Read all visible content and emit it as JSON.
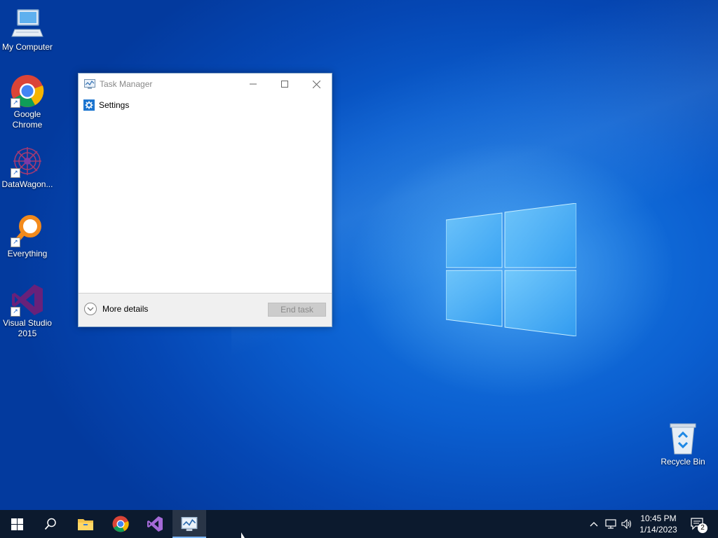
{
  "desktop": {
    "icons": [
      {
        "label": "My Computer"
      },
      {
        "label": "Google Chrome"
      },
      {
        "label": "DataWagon..."
      },
      {
        "label": "Everything"
      },
      {
        "label": "Visual Studio 2015"
      },
      {
        "label": "Recycle Bin"
      }
    ]
  },
  "task_manager": {
    "title": "Task Manager",
    "processes": [
      {
        "label": "Settings",
        "icon": "gear-icon"
      }
    ],
    "more_details_label": "More details",
    "end_task_label": "End task"
  },
  "taskbar": {
    "clock_time": "10:45 PM",
    "clock_date": "1/14/2023",
    "notification_count": "2"
  },
  "colors": {
    "accent": "#1b74cf",
    "taskbar": "#0c1a2e",
    "desktop": "#0b5fd0"
  }
}
